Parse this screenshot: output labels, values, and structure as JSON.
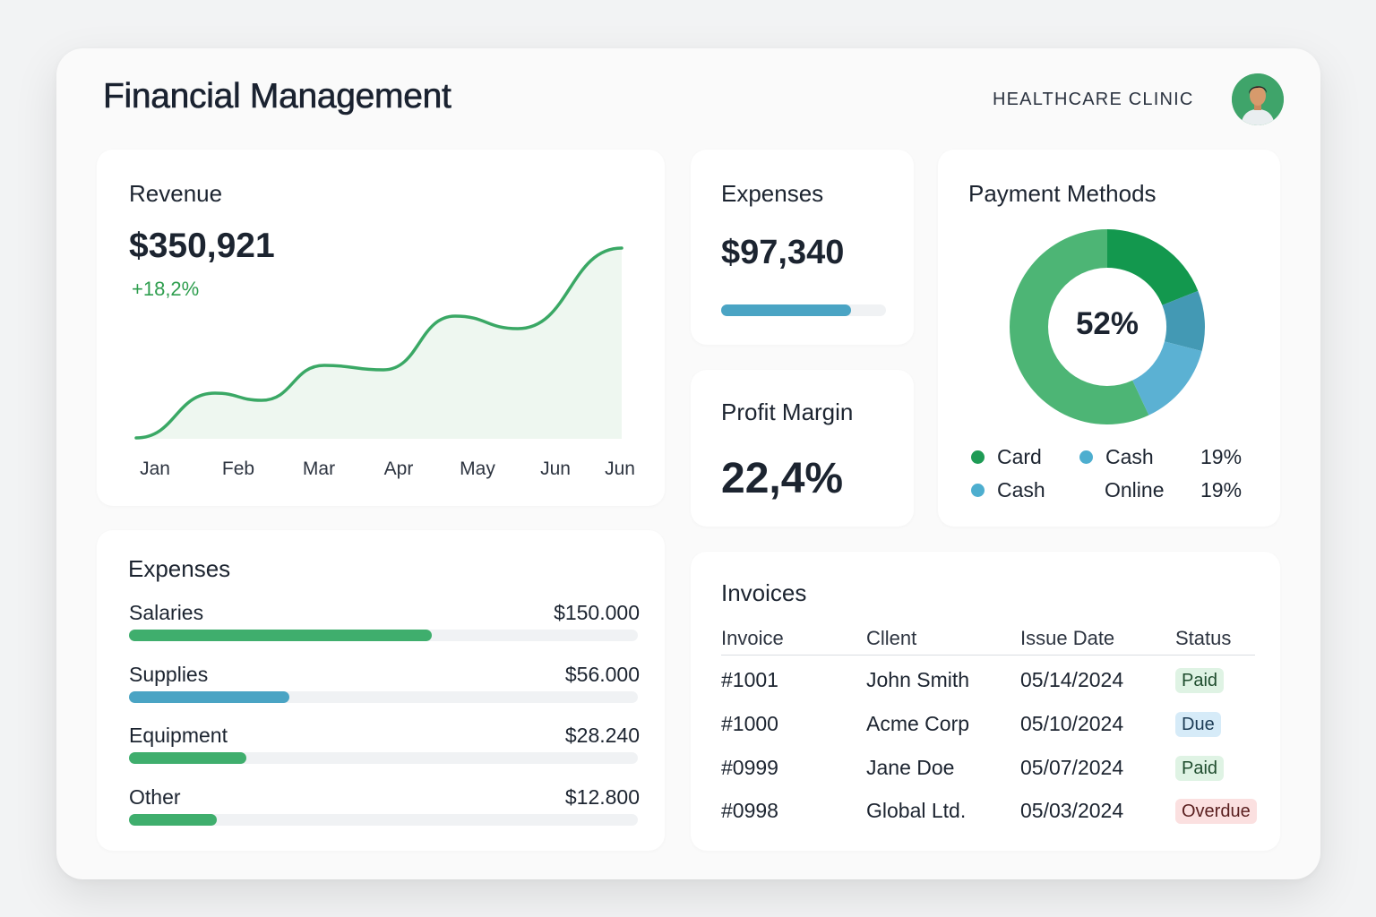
{
  "header": {
    "title": "Financial Management",
    "organization": "HEALTHCARE CLINIC"
  },
  "revenue": {
    "title": "Revenue",
    "amount": "$350,921",
    "change": "+18,2%",
    "chart_data": {
      "type": "area",
      "categories": [
        "Jan",
        "Feb",
        "Mar",
        "Apr",
        "May",
        "Jun",
        "Jun"
      ],
      "values": [
        0,
        49,
        81,
        96,
        133,
        142,
        213
      ],
      "color": "#3aa865"
    }
  },
  "expenses_summary": {
    "title": "Expenses",
    "amount": "$97,340",
    "progress": 0.79,
    "color": "#4aa4c4"
  },
  "profit_margin": {
    "title": "Profit Margin",
    "value": "22,4%"
  },
  "payment_methods": {
    "title": "Payment Methods",
    "center_label": "52%",
    "chart_data": {
      "type": "pie",
      "slices": [
        {
          "value": 19,
          "color": "#13984e"
        },
        {
          "value": 10,
          "color": "#4399b4"
        },
        {
          "value": 14,
          "color": "#5bb1d3"
        },
        {
          "value": 57,
          "color": "#4db575"
        }
      ]
    },
    "legend": [
      {
        "label": "Card",
        "color": "#1e9b55"
      },
      {
        "label": "Cash",
        "color": "#4daecf"
      },
      {
        "label": "Cash",
        "color": "#4daecf"
      }
    ],
    "online_label": "Online",
    "pct_1": "19%",
    "pct_2": "19%"
  },
  "expenses_breakdown": {
    "title": "Expenses",
    "items": [
      {
        "label": "Salaries",
        "value": "$150.000",
        "fraction": 0.595,
        "color": "#3fae6d"
      },
      {
        "label": "Supplies",
        "value": "$56.000",
        "fraction": 0.315,
        "color": "#4aa4c4"
      },
      {
        "label": "Equipment",
        "value": "$28.240",
        "fraction": 0.23,
        "color": "#3fae6d"
      },
      {
        "label": "Other",
        "value": "$12.800",
        "fraction": 0.172,
        "color": "#3fae6d"
      }
    ]
  },
  "invoices": {
    "title": "Invoices",
    "columns": [
      "Invoice",
      "Cllent",
      "Issue Date",
      "Status"
    ],
    "rows": [
      {
        "invoice": "#1001",
        "client": "John Smith",
        "date": "05/14/2024",
        "status": "Paid",
        "status_bg": "#dff3e4",
        "status_fg": "#1f4d2e"
      },
      {
        "invoice": "#1000",
        "client": "Acme Corp",
        "date": "05/10/2024",
        "status": "Due",
        "status_bg": "#d6ebf8",
        "status_fg": "#1d3c55"
      },
      {
        "invoice": "#0999",
        "client": "Jane Doe",
        "date": "05/07/2024",
        "status": "Paid",
        "status_bg": "#dff3e4",
        "status_fg": "#1f4d2e"
      },
      {
        "invoice": "#0998",
        "client": "Global Ltd.",
        "date": "05/03/2024",
        "status": "Overdue",
        "status_bg": "#fbe0e0",
        "status_fg": "#5a1f1f"
      }
    ]
  }
}
